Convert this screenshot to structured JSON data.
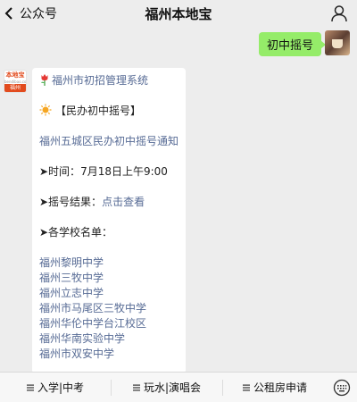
{
  "header": {
    "back_label": "公众号",
    "title": "福州本地宝"
  },
  "outgoing": {
    "text": "初中摇号"
  },
  "account_avatar": {
    "brand": "本地宝",
    "url": "bendibao.com",
    "city": "福州"
  },
  "card": {
    "system": "福州市初招管理系统",
    "section": "【民办初中摇号】",
    "notice": "福州五城区民办初中摇号通知",
    "time_label": "➤时间：",
    "time_value": "7月18日上午9:00",
    "result_label": "➤摇号结果：",
    "result_link": "点击查看",
    "schools_label": "➤各学校名单：",
    "schools": [
      "福州黎明中学",
      "福州三牧中学",
      "福州立志中学",
      "福州市马尾区三牧中学",
      "福州华伦中学台江校区",
      "福州华南实验中学",
      "福州市双安中学"
    ]
  },
  "menu": {
    "items": [
      "入学|中考",
      "玩水|演唱会",
      "公租房申请"
    ]
  },
  "icons": {
    "back": "chevron-left-icon",
    "user": "user-icon",
    "flower": "tulip-icon",
    "sun": "sun-icon",
    "menu": "hamburger-icon",
    "keyboard": "keyboard-icon"
  }
}
